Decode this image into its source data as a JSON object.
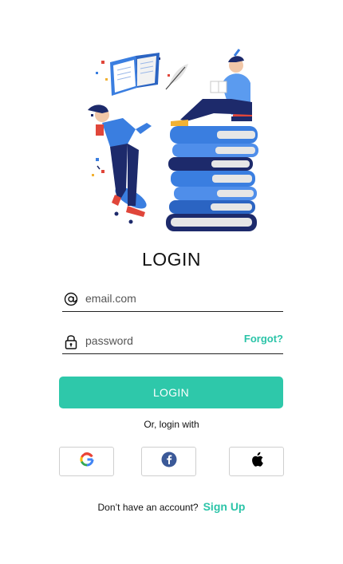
{
  "login": {
    "title": "LOGIN",
    "email": {
      "placeholder": "email.com",
      "icon": "at-icon"
    },
    "password": {
      "placeholder": "password",
      "icon": "lock-icon",
      "forgot_label": "Forgot?"
    },
    "submit_label": "LOGIN",
    "alt_login_text": "Or, login with",
    "social": [
      {
        "name": "google",
        "icon": "google-icon"
      },
      {
        "name": "facebook",
        "icon": "facebook-icon"
      },
      {
        "name": "apple",
        "icon": "apple-icon"
      }
    ],
    "signup_prompt": "Don’t have an account?",
    "signup_label": "Sign Up"
  },
  "colors": {
    "accent": "#2ec8aa",
    "link": "#2bc4a8",
    "navy": "#1d2a6b",
    "blue": "#3a7ee0"
  }
}
